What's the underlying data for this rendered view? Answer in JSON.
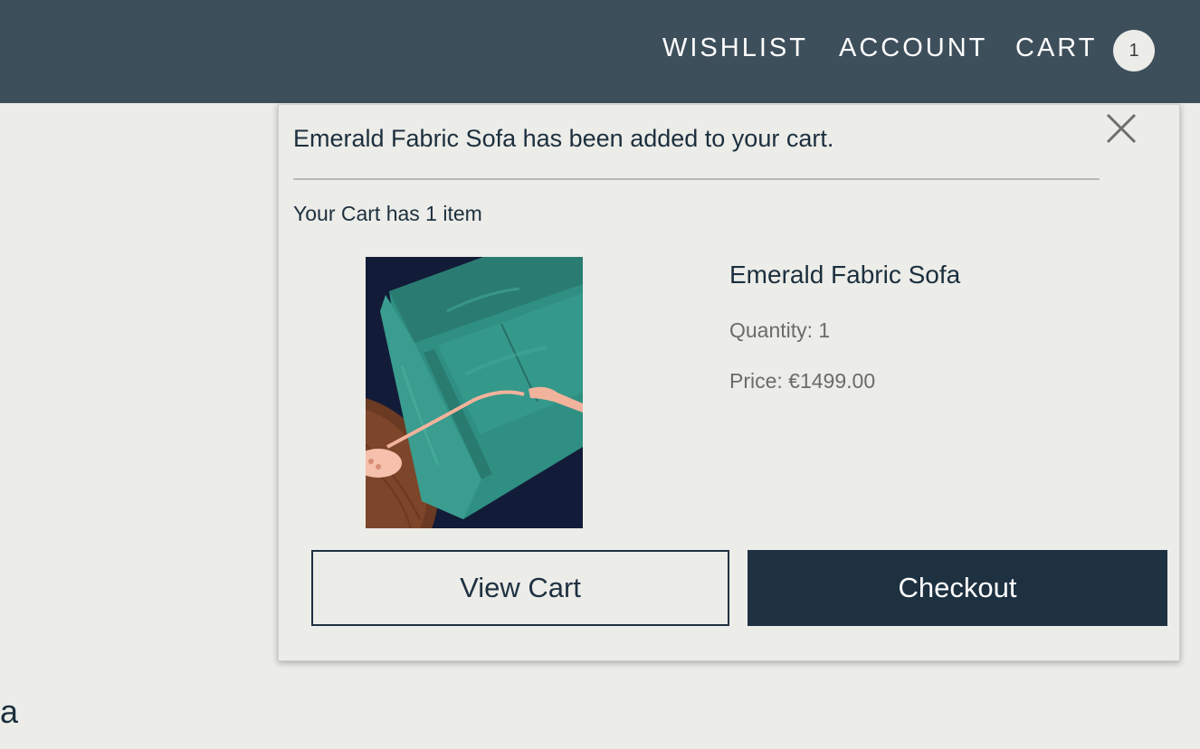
{
  "nav": {
    "wishlist": "WISHLIST",
    "account": "ACCOUNT",
    "cart": "CART",
    "cart_count": "1"
  },
  "popup": {
    "added_message": "Emerald Fabric Sofa has been added to your cart.",
    "cart_summary": "Your Cart has 1 item",
    "product": {
      "name": "Emerald Fabric Sofa",
      "quantity": "Quantity: 1",
      "price": "Price: €1499.00"
    },
    "view_cart_label": "View Cart",
    "checkout_label": "Checkout"
  },
  "page": {
    "partial_text": "a"
  },
  "colors": {
    "header_bg": "#3e4f5c",
    "page_bg": "#ecece8",
    "primary": "#1e3141",
    "muted_text": "#6b6b6b"
  }
}
